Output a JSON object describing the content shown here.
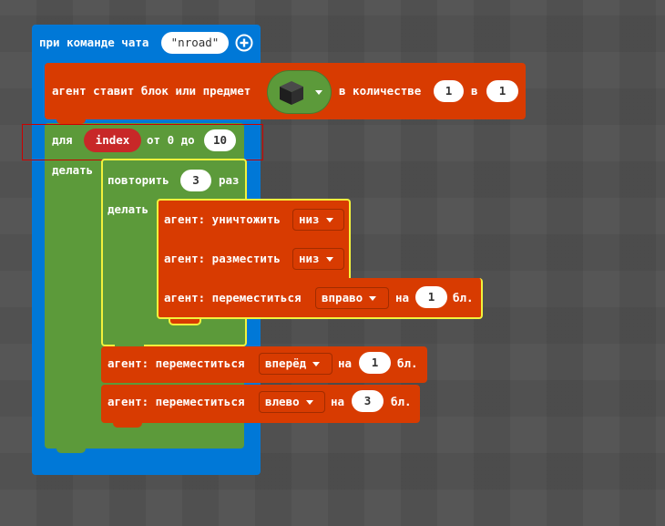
{
  "colors": {
    "workspace": "#555555",
    "event_blue": "#0078D7",
    "agent_orange": "#D83B01",
    "loop_green": "#5C9A3A",
    "highlight_yellow": "#F2F23C",
    "variable_red": "#C82828",
    "selection_red": "#CC0000"
  },
  "event": {
    "label": "при команде чата",
    "command": "\"nroad\"",
    "add_icon": "plus-circle-icon"
  },
  "place_block": {
    "label": "агент ставит блок или предмет",
    "item_icon": "black-cube-icon",
    "count_label": "в количестве",
    "count": "1",
    "slot_label": "в",
    "slot": "1"
  },
  "for_loop": {
    "for_label": "для",
    "variable": "index",
    "range_label": "от 0 до",
    "end": "10",
    "do_label": "делать"
  },
  "repeat": {
    "label": "повторить",
    "times": "3",
    "suffix": "раз",
    "do_label": "делать"
  },
  "inner_actions": {
    "destroy_label": "агент: уничтожить",
    "destroy_dir": "низ",
    "place_label": "агент: разместить",
    "place_dir": "низ",
    "move_label": "агент: переместиться",
    "move_dir": "вправо",
    "move_on": "на",
    "move_amount": "1",
    "move_unit": "бл."
  },
  "move_forward": {
    "label": "агент: переместиться",
    "dir": "вперёд",
    "on": "на",
    "amount": "1",
    "unit": "бл."
  },
  "move_left": {
    "label": "агент: переместиться",
    "dir": "влево",
    "on": "на",
    "amount": "3",
    "unit": "бл."
  }
}
